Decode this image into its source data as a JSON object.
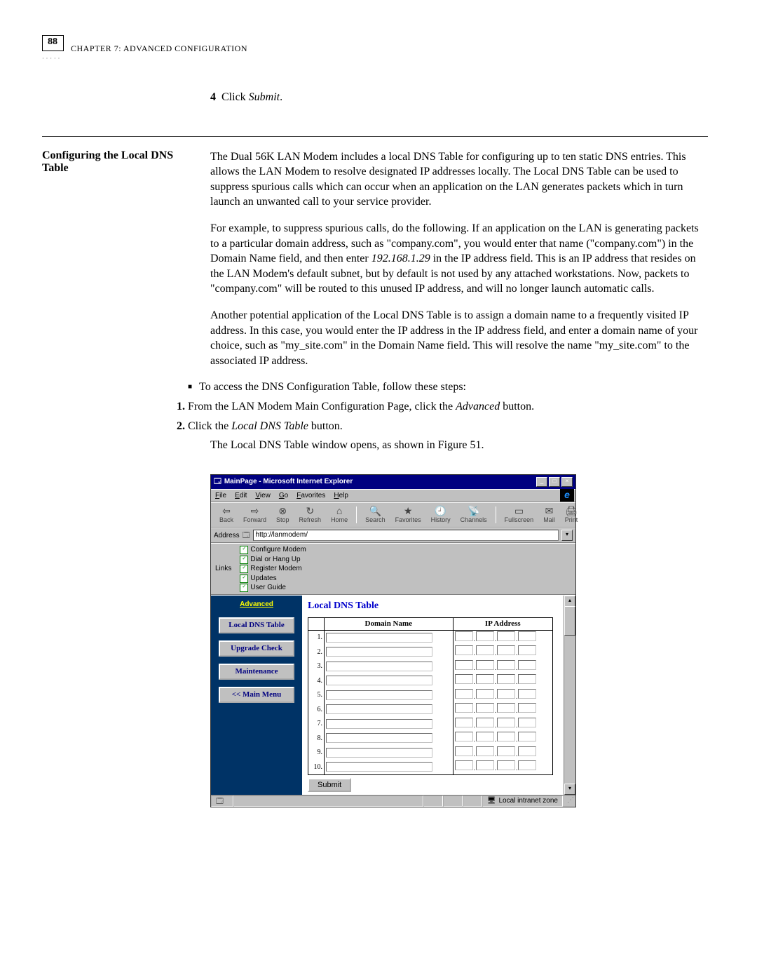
{
  "page_number": "88",
  "chapter_header": "CHAPTER 7: ADVANCED CONFIGURATION",
  "step4_num": "4",
  "step4_text_prefix": "Click ",
  "step4_text_em": "Submit",
  "step4_text_suffix": ".",
  "section_heading": "Configuring the Local DNS Table",
  "para1": "The Dual 56K LAN Modem includes a local DNS Table for configuring up to ten static DNS entries. This allows the LAN Modem to resolve designated IP addresses locally. The Local DNS Table can be used to suppress spurious calls which can occur when an application on the LAN generates packets which in turn launch an unwanted call to your service provider.",
  "para2_a": "For example, to suppress spurious calls, do the following. If an application on the LAN is generating packets to a particular domain address, such as \"company.com\", you would enter that name (\"company.com\") in the Domain Name field, and then enter ",
  "para2_em": "192.168.1.29",
  "para2_b": " in the IP address field. This is an IP address that resides on the LAN Modem's default subnet, but by default is not used by any attached workstations. Now, packets to \"company.com\" will be routed to this unused IP address, and will no longer launch automatic calls.",
  "para3": "Another potential application of the Local DNS Table is to assign a domain name to a frequently visited IP address. In this case, you would enter the IP address in the IP address field, and enter a domain name of your choice, such as \"my_site.com\" in the Domain Name field. This will resolve the name \"my_site.com\" to the associated IP address.",
  "bullet1": "To access the DNS Configuration Table, follow these steps:",
  "step1_num": "1",
  "step1_a": "From the LAN Modem Main Configuration Page, click the ",
  "step1_em": "Advanced",
  "step1_b": " button.",
  "step2_num": "2",
  "step2_a": "Click the ",
  "step2_em": "Local DNS Table",
  "step2_b": " button.",
  "post_step": "The Local DNS Table window opens, as shown in Figure 51.",
  "browser": {
    "title": "MainPage - Microsoft Internet Explorer",
    "menus": [
      "File",
      "Edit",
      "View",
      "Go",
      "Favorites",
      "Help"
    ],
    "toolbar": [
      {
        "icon": "⇦",
        "label": "Back"
      },
      {
        "icon": "⇨",
        "label": "Forward"
      },
      {
        "icon": "⊗",
        "label": "Stop"
      },
      {
        "icon": "↻",
        "label": "Refresh"
      },
      {
        "icon": "⌂",
        "label": "Home"
      },
      {
        "icon": "🔍",
        "label": "Search"
      },
      {
        "icon": "★",
        "label": "Favorites"
      },
      {
        "icon": "🕘",
        "label": "History"
      },
      {
        "icon": "📡",
        "label": "Channels"
      },
      {
        "icon": "▭",
        "label": "Fullscreen"
      },
      {
        "icon": "✉",
        "label": "Mail"
      },
      {
        "icon": "🖨",
        "label": "Print"
      }
    ],
    "address_label": "Address",
    "address_value": "http://lanmodem/",
    "links_label": "Links",
    "links": [
      "Configure Modem",
      "Dial or Hang Up",
      "Register Modem",
      "Updates",
      "User Guide"
    ],
    "nav_heading": "Advanced",
    "nav_buttons": [
      "Local DNS Table",
      "Upgrade Check",
      "Maintenance",
      "<< Main Menu"
    ],
    "dns_title": "Local DNS Table",
    "col_domain": "Domain Name",
    "col_ip": "IP Address",
    "rows": [
      "1.",
      "2.",
      "3.",
      "4.",
      "5.",
      "6.",
      "7.",
      "8.",
      "9.",
      "10."
    ],
    "submit": "Submit",
    "status_zone": "Local intranet zone"
  }
}
